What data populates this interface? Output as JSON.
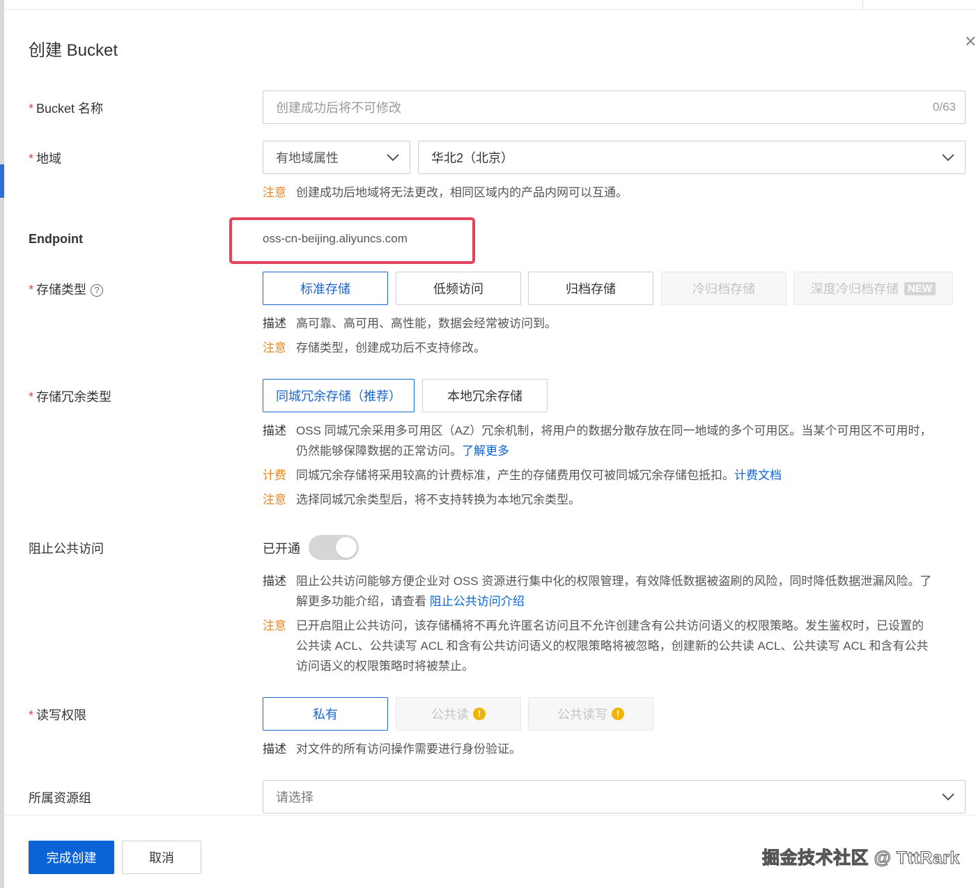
{
  "dialog": {
    "title": "创建 Bucket",
    "close_icon": "close-icon"
  },
  "bucket_name": {
    "label": "Bucket 名称",
    "placeholder": "创建成功后将不可修改",
    "counter": "0/63"
  },
  "region": {
    "label": "地域",
    "attribute_select": "有地域属性",
    "region_select": "华北2（北京）",
    "note_tag": "注意",
    "note_text": "创建成功后地域将无法更改，相同区域内的产品内网可以互通。"
  },
  "endpoint": {
    "label": "Endpoint",
    "value": "oss-cn-beijing.aliyuncs.com"
  },
  "storage_class": {
    "label": "存储类型",
    "help_icon": "?",
    "options": [
      {
        "label": "标准存储",
        "state": "active"
      },
      {
        "label": "低频访问",
        "state": "normal"
      },
      {
        "label": "归档存储",
        "state": "normal"
      },
      {
        "label": "冷归档存储",
        "state": "disabled"
      },
      {
        "label": "深度冷归档存储",
        "state": "disabled",
        "badge": "NEW"
      }
    ],
    "desc_tag": "描述",
    "desc_text": "高可靠、高可用、高性能，数据会经常被访问到。",
    "note_tag": "注意",
    "note_text": "存储类型，创建成功后不支持修改。"
  },
  "redundancy": {
    "label": "存储冗余类型",
    "options": [
      {
        "label": "同城冗余存储（推荐）",
        "state": "active"
      },
      {
        "label": "本地冗余存储",
        "state": "normal"
      }
    ],
    "desc_tag": "描述",
    "desc_line1": "OSS 同城冗余采用多可用区（AZ）冗余机制，将用户的数据分散存放在同一地域的多个可用区。当某个可用区不可用时，",
    "desc_line2": "仍然能够保障数据的正常访问。",
    "desc_link": "了解更多",
    "billing_tag": "计费",
    "billing_text": "同城冗余存储将采用较高的计费标准，产生的存储费用仅可被同城冗余存储包抵扣。",
    "billing_link": "计费文档",
    "note_tag": "注意",
    "note_text": "选择同城冗余类型后，将不支持转换为本地冗余类型。"
  },
  "block_public": {
    "label": "阻止公共访问",
    "toggle_label": "已开通",
    "enabled": true,
    "desc_tag": "描述",
    "desc_line1": "阻止公共访问能够方便企业对 OSS 资源进行集中化的权限管理，有效降低数据被盗刷的风险，同时降低数据泄漏风险。了",
    "desc_line2": "解更多功能介绍，请查看",
    "desc_link": "阻止公共访问介绍",
    "note_tag": "注意",
    "note_line1": "已开启阻止公共访问，该存储桶将不再允许匿名访问且不允许创建含有公共访问语义的权限策略。发生鉴权时，已设置的",
    "note_line2": "公共读 ACL、公共读写 ACL 和含有公共访问语义的权限策略将被忽略，创建新的公共读 ACL、公共读写 ACL 和含有公共",
    "note_line3": "访问语义的权限策略时将被禁止。"
  },
  "acl": {
    "label": "读写权限",
    "options": [
      {
        "label": "私有",
        "state": "active"
      },
      {
        "label": "公共读",
        "state": "disabled",
        "warn": "!"
      },
      {
        "label": "公共读写",
        "state": "disabled",
        "warn": "!"
      }
    ],
    "desc_tag": "描述",
    "desc_text": "对文件的所有访问操作需要进行身份验证。"
  },
  "resource_group": {
    "label": "所属资源组",
    "placeholder": "请选择"
  },
  "footer": {
    "submit": "完成创建",
    "cancel": "取消"
  },
  "watermark": "掘金技术社区 @ TttRark",
  "colors": {
    "accent": "#0b64d6",
    "warning_tag": "#e8861a",
    "required": "#e64c3c",
    "highlight_box": "#e3435b"
  }
}
